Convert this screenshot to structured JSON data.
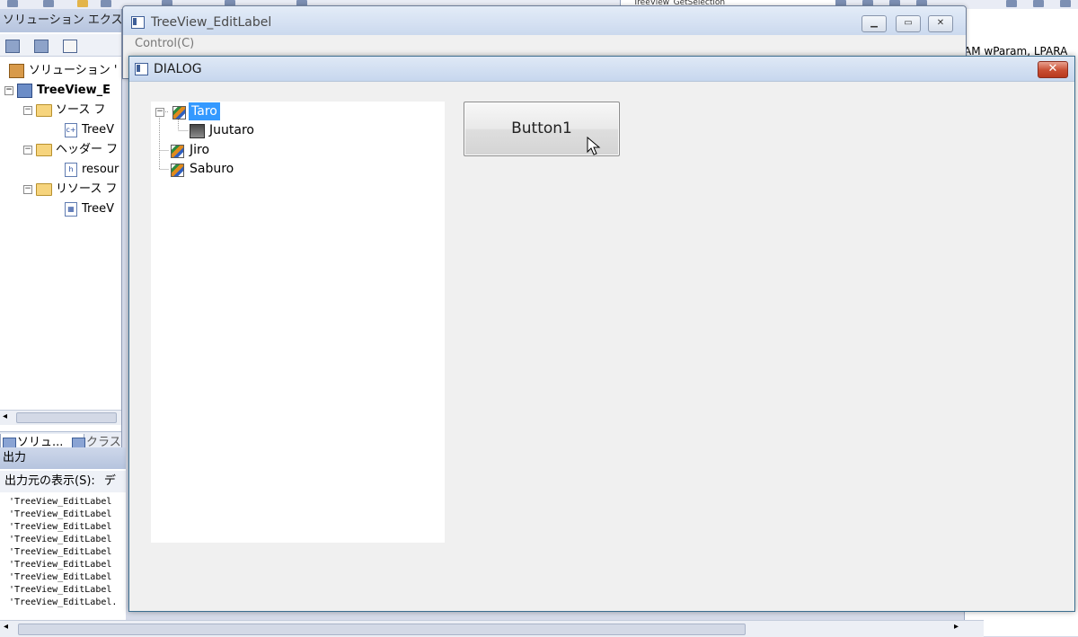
{
  "ide": {
    "toolbar_combo": "TreeView_GetSelection",
    "solution_explorer": {
      "title": "ソリューション エクス",
      "items": [
        {
          "label": "ソリューション '"
        },
        {
          "label": "TreeView_E"
        },
        {
          "label": "ソース フ"
        },
        {
          "label": "TreeV"
        },
        {
          "label": "ヘッダー フ"
        },
        {
          "label": "resour"
        },
        {
          "label": "リソース フ"
        },
        {
          "label": "TreeV"
        }
      ],
      "tabs": [
        {
          "label": "ソリュ..."
        },
        {
          "label": "クラス"
        }
      ]
    },
    "output": {
      "title": "出力",
      "source_label": "出力元の表示(S):",
      "source_value": "デ",
      "lines": [
        "'TreeView_EditLabel",
        "'TreeView_EditLabel",
        "'TreeView_EditLabel",
        "'TreeView_EditLabel",
        "'TreeView_EditLabel",
        "'TreeView_EditLabel",
        "'TreeView_EditLabel",
        "'TreeView_EditLabel",
        "'TreeView_EditLabel."
      ]
    },
    "code_fragment": "AM wParam, LPARA"
  },
  "main_window": {
    "title": "TreeView_EditLabel",
    "menu": [
      "Control(C)"
    ]
  },
  "dialog": {
    "title": "DIALOG",
    "tree": [
      {
        "label": "Taro",
        "icon": "pencil-icon",
        "selected": true
      },
      {
        "label": "Juutaro",
        "icon": "photo-icon",
        "selected": false
      },
      {
        "label": "Jiro",
        "icon": "pencil-icon",
        "selected": false
      },
      {
        "label": "Saburo",
        "icon": "pencil-icon",
        "selected": false
      }
    ],
    "button1": "Button1"
  },
  "colors": {
    "selection": "#3399ff",
    "close_button": "#c84d32",
    "title_bar": "#c7d7ee"
  }
}
